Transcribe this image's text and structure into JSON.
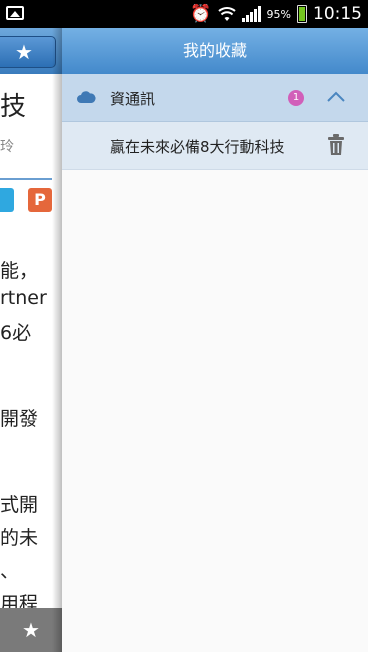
{
  "status_bar": {
    "battery_text": "95%",
    "time": "10:15",
    "icons": [
      "gallery-icon",
      "alarm-icon",
      "wifi-icon",
      "signal-icon",
      "battery-icon"
    ]
  },
  "left_page": {
    "title_fragment": "技",
    "author_fragment": "玲",
    "share_icons": [
      "twitter-icon",
      "plurk-icon"
    ],
    "plurk_glyph": "P",
    "body_lines": [
      "能，",
      "rtner",
      "6必",
      "開發",
      "式開",
      "的未",
      "、",
      "用程"
    ],
    "bottom_star_glyph": "★",
    "header_star_glyph": "★"
  },
  "drawer": {
    "title": "我的收藏",
    "category": {
      "label": "資通訊",
      "count": "1"
    },
    "items": [
      {
        "label": "贏在未來必備8大行動科技"
      }
    ]
  },
  "colors": {
    "header_blue": "#4389cb",
    "category_bg": "#c4d8ec",
    "item_bg": "#dfe9f3",
    "badge": "#d15fb9"
  }
}
